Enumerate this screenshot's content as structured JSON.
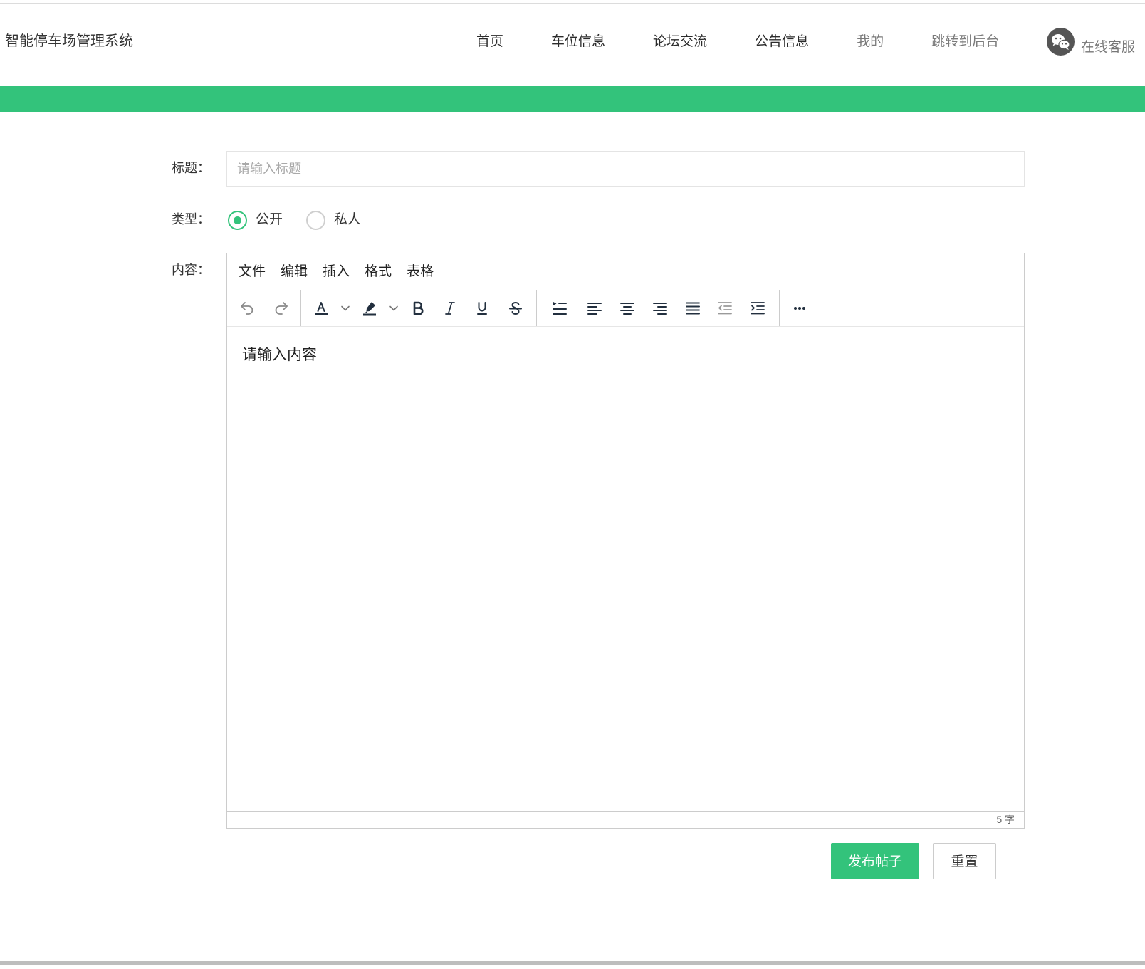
{
  "header": {
    "logo": "智能停车场管理系统",
    "nav": [
      {
        "label": "首页"
      },
      {
        "label": "车位信息"
      },
      {
        "label": "论坛交流"
      },
      {
        "label": "公告信息"
      },
      {
        "label": "我的"
      },
      {
        "label": "跳转到后台"
      }
    ],
    "service": {
      "icon": "wechat-icon",
      "label": "在线客服"
    }
  },
  "form": {
    "title": {
      "label": "标题：",
      "placeholder": "请输入标题",
      "value": ""
    },
    "type": {
      "label": "类型：",
      "options": [
        {
          "label": "公开",
          "checked": true
        },
        {
          "label": "私人",
          "checked": false
        }
      ]
    },
    "content": {
      "label": "内容："
    }
  },
  "editor": {
    "menus": [
      "文件",
      "编辑",
      "插入",
      "格式",
      "表格"
    ],
    "toolbar_icons": [
      "undo-icon",
      "redo-icon",
      "font-color-icon",
      "highlight-color-icon",
      "bold-icon",
      "italic-icon",
      "underline-icon",
      "strikethrough-icon",
      "line-height-icon",
      "align-left-icon",
      "align-center-icon",
      "align-right-icon",
      "align-justify-icon",
      "outdent-icon",
      "indent-icon",
      "more-icon"
    ],
    "content": "请输入内容",
    "word_count": "5 字"
  },
  "actions": {
    "submit": "发布帖子",
    "reset": "重置"
  },
  "colors": {
    "accent": "#33c37b",
    "text": "#333333",
    "muted": "#7a7a7a",
    "border": "#cccccc"
  }
}
